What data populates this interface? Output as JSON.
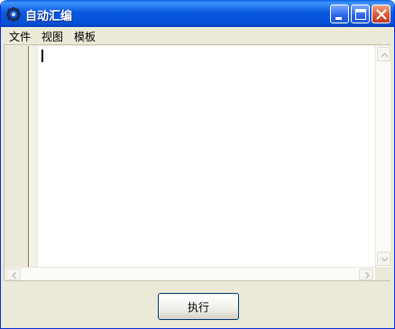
{
  "window": {
    "title": "自动汇编",
    "icons": {
      "app": "app-gear-icon",
      "minimize": "minimize-icon",
      "maximize": "maximize-icon",
      "close": "close-icon"
    }
  },
  "menu": {
    "items": [
      "文件",
      "视图",
      "模板"
    ]
  },
  "editor": {
    "content": ""
  },
  "actions": {
    "run_label": "执行"
  },
  "colors": {
    "titlebar": "#0a5adf",
    "close_button": "#dd5533",
    "window_bg": "#ece9d8"
  }
}
